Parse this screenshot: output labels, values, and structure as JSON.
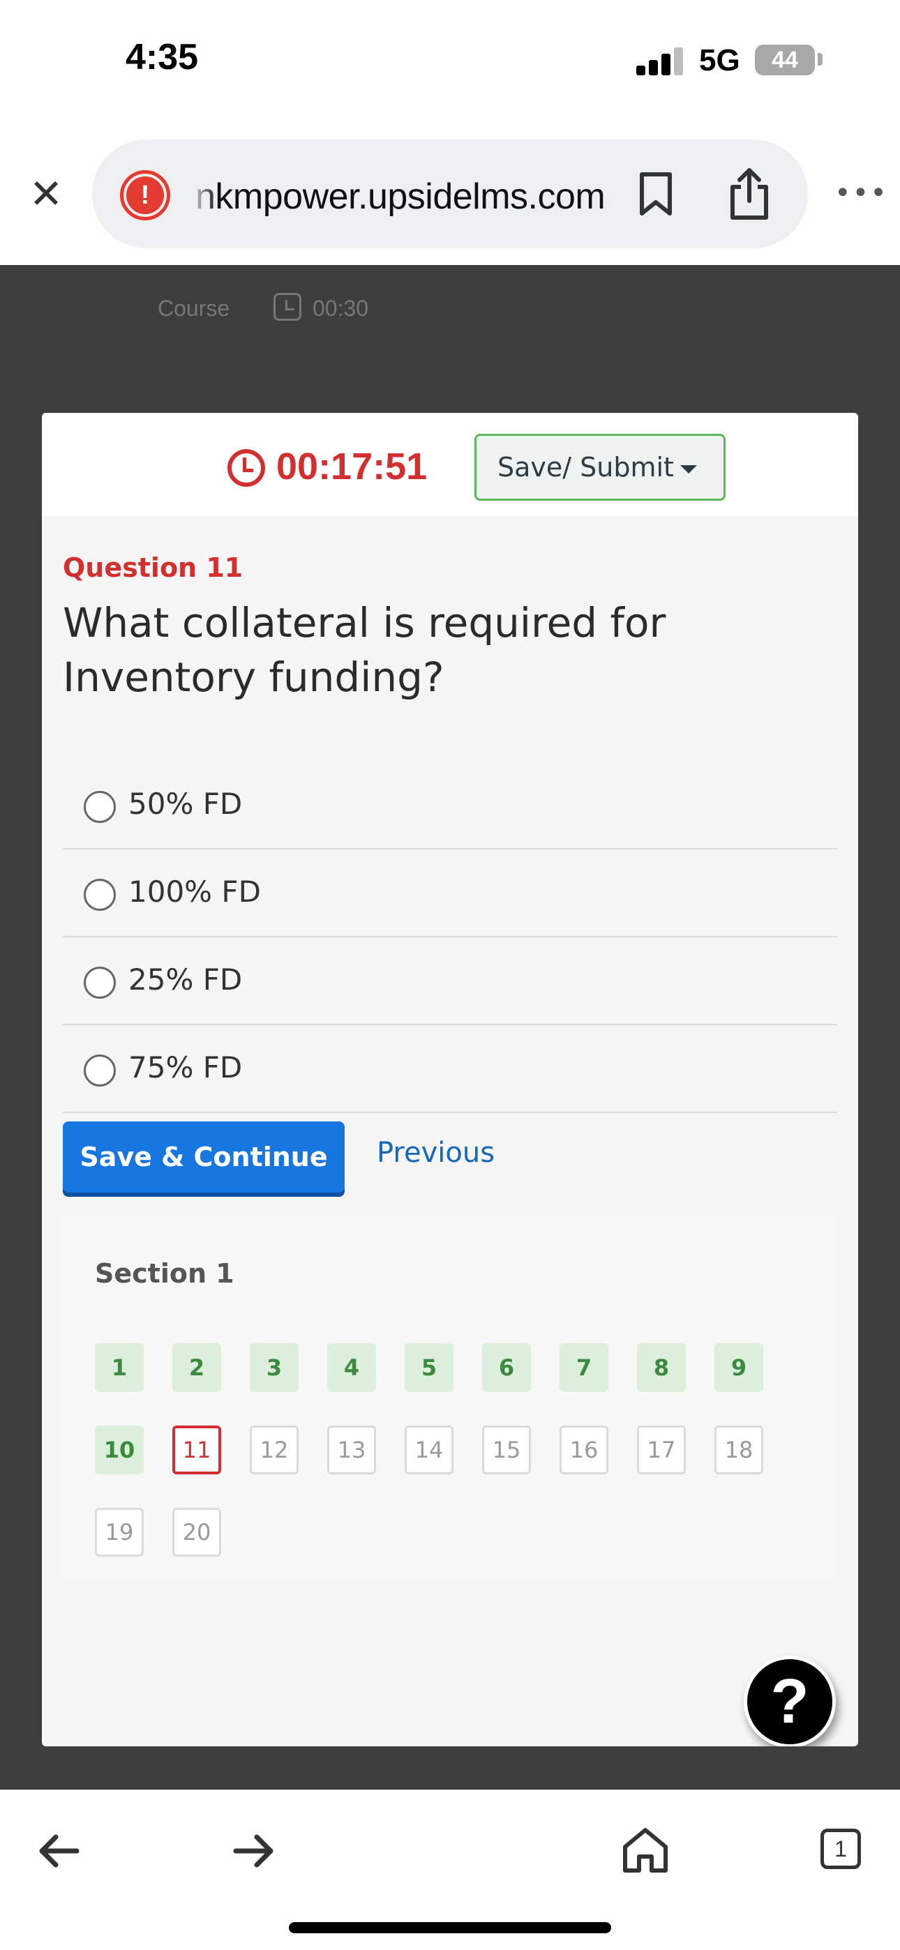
{
  "status_bar": {
    "time": "4:35",
    "network": "5G",
    "battery": "44"
  },
  "browser": {
    "url": "nkmpower.upsidelms.com",
    "close_icon": "close-icon",
    "warning_icon": "warning-icon",
    "bookmark_icon": "bookmark-icon",
    "share_icon": "share-icon",
    "more_icon": "more-icon"
  },
  "page": {
    "breadcrumb": "Course",
    "elapsed": "00:30"
  },
  "quiz": {
    "timer": "00:17:51",
    "save_submit_label": "Save/ Submit",
    "question_label": "Question 11",
    "question_text": "What collateral is required for Inventory funding?",
    "options": [
      "50% FD",
      "100% FD",
      "25% FD",
      "75% FD"
    ],
    "primary_button": "Save & Continue",
    "secondary_link": "Previous",
    "section_title": "Section 1",
    "questions": [
      {
        "num": "1",
        "state": "answered"
      },
      {
        "num": "2",
        "state": "answered"
      },
      {
        "num": "3",
        "state": "answered"
      },
      {
        "num": "4",
        "state": "answered"
      },
      {
        "num": "5",
        "state": "answered"
      },
      {
        "num": "6",
        "state": "answered"
      },
      {
        "num": "7",
        "state": "answered"
      },
      {
        "num": "8",
        "state": "answered"
      },
      {
        "num": "9",
        "state": "answered"
      },
      {
        "num": "10",
        "state": "answered"
      },
      {
        "num": "11",
        "state": "current"
      },
      {
        "num": "12",
        "state": "unanswered"
      },
      {
        "num": "13",
        "state": "unanswered"
      },
      {
        "num": "14",
        "state": "unanswered"
      },
      {
        "num": "15",
        "state": "unanswered"
      },
      {
        "num": "16",
        "state": "unanswered"
      },
      {
        "num": "17",
        "state": "unanswered"
      },
      {
        "num": "18",
        "state": "unanswered"
      },
      {
        "num": "19",
        "state": "unanswered"
      },
      {
        "num": "20",
        "state": "unanswered"
      }
    ],
    "help_label": "?"
  },
  "toolbar": {
    "tab_count": "1"
  },
  "colors": {
    "accent_red": "#d32f2f",
    "primary_blue": "#1776e0",
    "answered_green": "#3b8a3f"
  }
}
